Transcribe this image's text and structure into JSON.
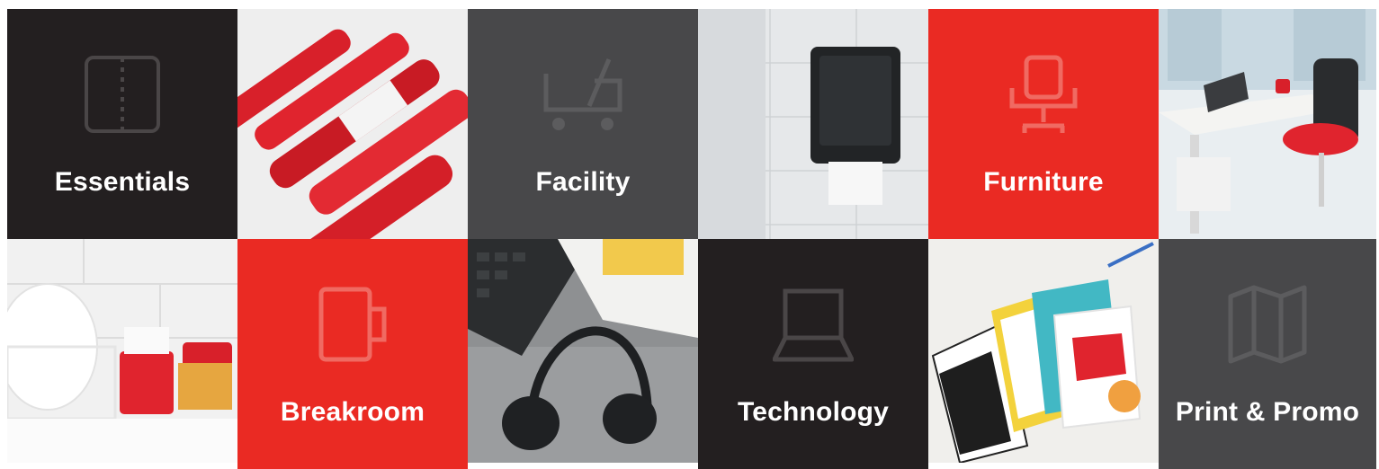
{
  "colors": {
    "dark": "#231f20",
    "grey": "#48484a",
    "red": "#ea2a23",
    "label": "#ffffff"
  },
  "tiles": [
    {
      "label": "Essentials",
      "icon": "binder-icon",
      "style": "dark"
    },
    {
      "photo": "red-markers-photo"
    },
    {
      "label": "Facility",
      "icon": "cart-icon",
      "style": "grey"
    },
    {
      "photo": "paper-towel-dispenser-photo"
    },
    {
      "label": "Furniture",
      "icon": "office-chair-icon",
      "style": "red"
    },
    {
      "photo": "office-desk-chair-photo"
    },
    {
      "photo": "breakroom-dishes-photo"
    },
    {
      "label": "Breakroom",
      "icon": "mug-icon",
      "style": "red"
    },
    {
      "photo": "headset-keyboard-photo"
    },
    {
      "label": "Technology",
      "icon": "laptop-icon",
      "style": "dark"
    },
    {
      "photo": "printed-booklets-photo"
    },
    {
      "label": "Print & Promo",
      "icon": "folded-map-icon",
      "style": "grey"
    }
  ]
}
